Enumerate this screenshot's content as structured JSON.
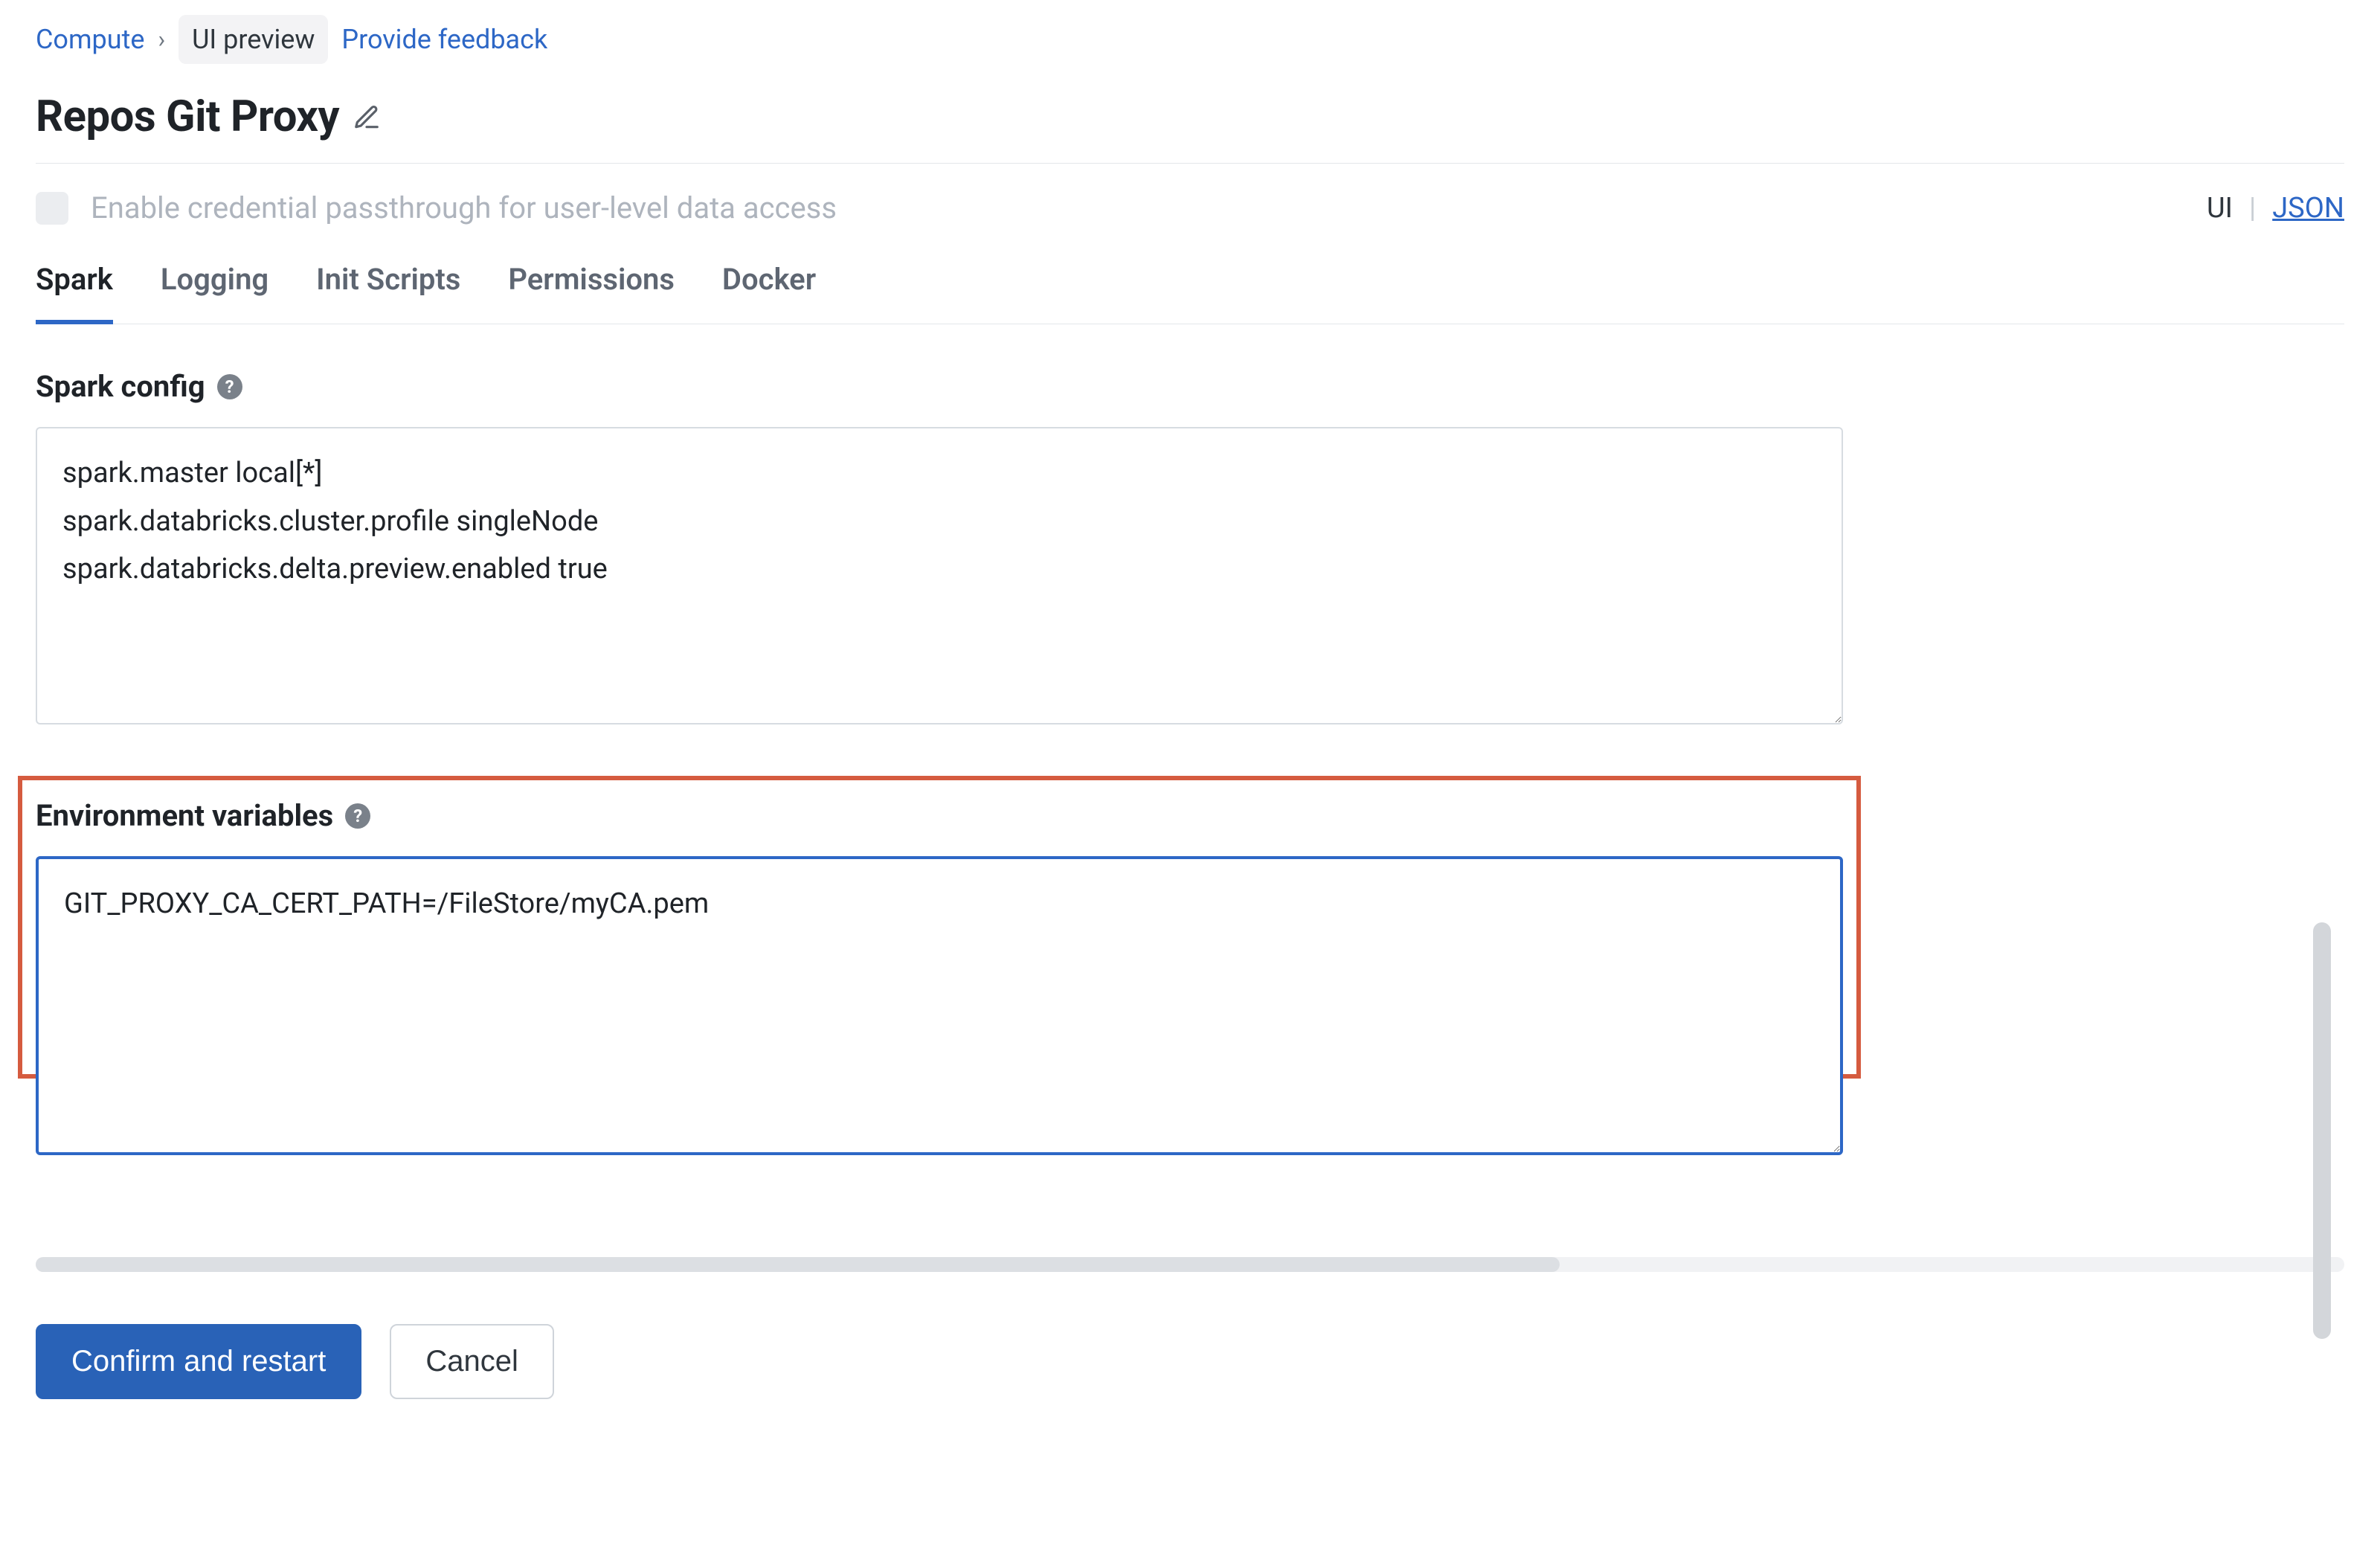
{
  "breadcrumb": {
    "root": "Compute",
    "current": "UI preview",
    "feedback": "Provide feedback"
  },
  "title": "Repos Git Proxy",
  "passthrough": {
    "label": "Enable credential passthrough for user-level data access"
  },
  "view_toggle": {
    "ui": "UI",
    "sep": "|",
    "json": "JSON"
  },
  "tabs": [
    {
      "id": "spark",
      "label": "Spark",
      "active": true
    },
    {
      "id": "logging",
      "label": "Logging",
      "active": false
    },
    {
      "id": "init",
      "label": "Init Scripts",
      "active": false
    },
    {
      "id": "perm",
      "label": "Permissions",
      "active": false
    },
    {
      "id": "docker",
      "label": "Docker",
      "active": false
    }
  ],
  "spark_config": {
    "title": "Spark config",
    "value": "spark.master local[*]\nspark.databricks.cluster.profile singleNode\nspark.databricks.delta.preview.enabled true"
  },
  "env_vars": {
    "title": "Environment variables",
    "value": "GIT_PROXY_CA_CERT_PATH=/FileStore/myCA.pem",
    "highlighted_prefix": "GIT_PROXY_CA_CERT_PATH"
  },
  "footer": {
    "confirm": "Confirm and restart",
    "cancel": "Cancel"
  }
}
